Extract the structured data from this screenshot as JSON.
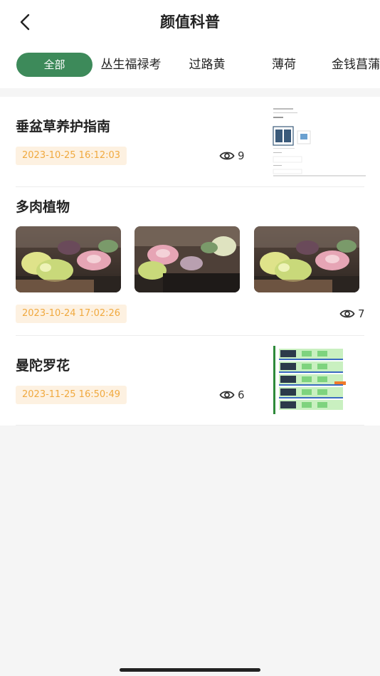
{
  "header": {
    "title": "颜值科普",
    "back_icon": "chevron-left-icon"
  },
  "tabs": [
    {
      "label": "全部",
      "active": true
    },
    {
      "label": "丛生福禄考",
      "active": false
    },
    {
      "label": "过路黄",
      "active": false
    },
    {
      "label": "薄荷",
      "active": false
    },
    {
      "label": "金钱菖蒲",
      "active": false
    }
  ],
  "articles": [
    {
      "title": "垂盆草养护指南",
      "date": "2023-10-25 16:12:03",
      "views": "9",
      "thumbnail": "screenshot-thumbnail"
    },
    {
      "title": "多肉植物",
      "date": "2023-10-24 17:02:26",
      "views": "7",
      "photos": [
        "succulent-photo",
        "succulent-photo",
        "succulent-photo"
      ]
    },
    {
      "title": "曼陀罗花",
      "date": "2023-11-25 16:50:49",
      "views": "6",
      "thumbnail": "table-screenshot-thumbnail"
    }
  ],
  "colors": {
    "accent": "#3d8a5a",
    "date_text": "#f0a93f",
    "date_bg": "#fdf1e1",
    "background": "#f5f5f5"
  }
}
